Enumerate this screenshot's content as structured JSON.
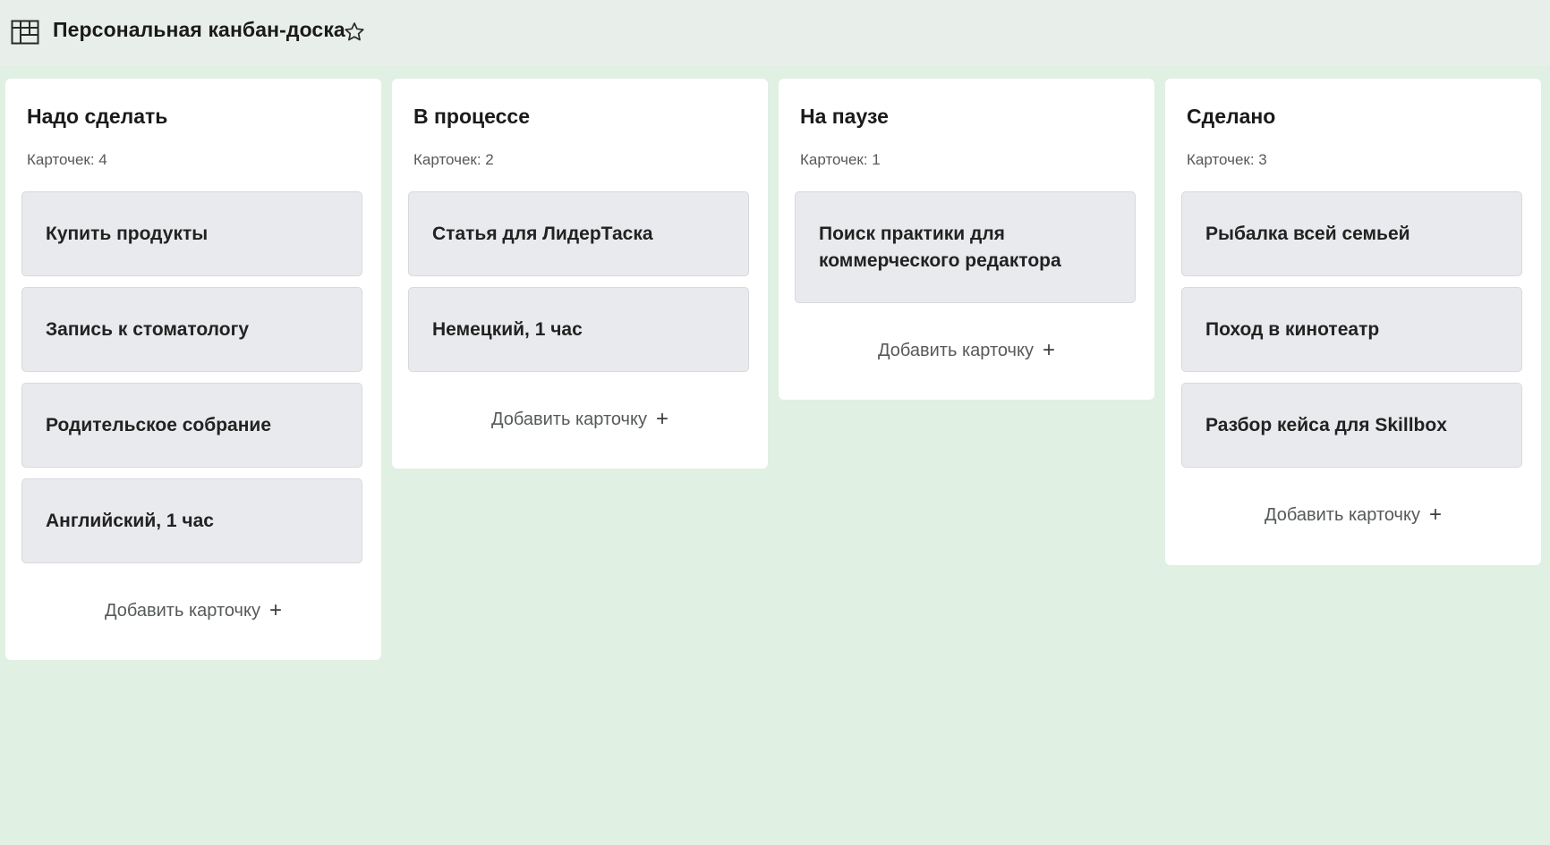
{
  "board": {
    "title": "Персональная канбан-доска",
    "icon": "kanban-board-icon",
    "favorite_icon": "star-outline-icon"
  },
  "colors": {
    "background": "#e0f0e3",
    "topbar": "#e8efea",
    "column": "#ffffff",
    "card": "#e9eaed"
  },
  "columns": [
    {
      "title": "Надо сделать",
      "count": "Карточек: 4",
      "cards": [
        "Купить продукты",
        "Запись к стоматологу",
        "Родительское собрание",
        "Английский, 1 час"
      ],
      "add_label": "Добавить карточку",
      "add_icon": "+"
    },
    {
      "title": "В процессе",
      "count": "Карточек: 2",
      "cards": [
        "Статья для ЛидерТаска",
        "Немецкий, 1 час"
      ],
      "add_label": "Добавить карточку",
      "add_icon": "+"
    },
    {
      "title": "На паузе",
      "count": "Карточек: 1",
      "cards": [
        "Поиск практики для коммерческого редактора"
      ],
      "add_label": "Добавить карточку",
      "add_icon": "+"
    },
    {
      "title": "Сделано",
      "count": "Карточек: 3",
      "cards": [
        "Рыбалка всей семьей",
        "Поход в кинотеатр",
        "Разбор кейса для Skillbox"
      ],
      "add_label": "Добавить карточку",
      "add_icon": "+"
    }
  ]
}
